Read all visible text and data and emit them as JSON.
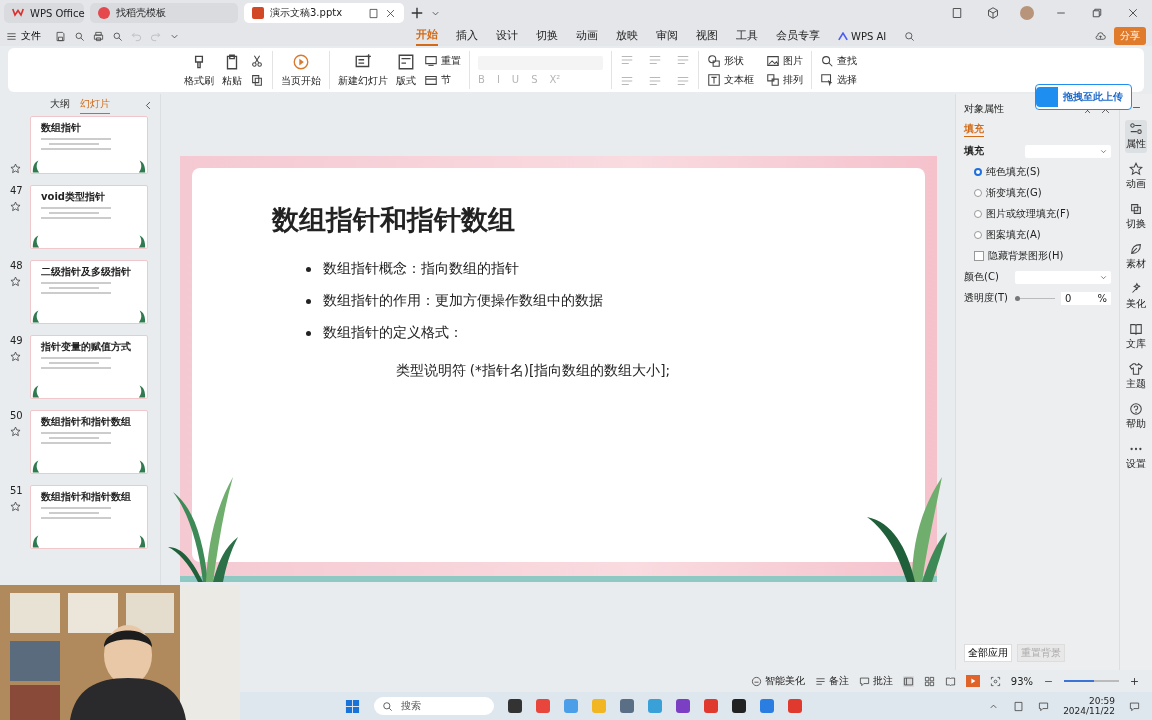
{
  "title_tabs": [
    {
      "label": "WPS Office",
      "selected": false
    },
    {
      "label": "找稻壳模板",
      "selected": false
    },
    {
      "label": "演示文稿3.pptx",
      "selected": true
    }
  ],
  "file_menu": "文件",
  "ribbon_tabs": [
    {
      "label": "开始",
      "selected": true
    },
    {
      "label": "插入",
      "selected": false
    },
    {
      "label": "设计",
      "selected": false
    },
    {
      "label": "切换",
      "selected": false
    },
    {
      "label": "动画",
      "selected": false
    },
    {
      "label": "放映",
      "selected": false
    },
    {
      "label": "审阅",
      "selected": false
    },
    {
      "label": "视图",
      "selected": false
    },
    {
      "label": "工具",
      "selected": false
    },
    {
      "label": "会员专享",
      "selected": false
    }
  ],
  "ai_tab": "WPS AI",
  "share_button": "分享",
  "ribbon": {
    "clipboard": [
      {
        "label": "格式刷"
      },
      {
        "label": "粘贴"
      }
    ],
    "play": "当页开始",
    "slides": [
      {
        "label": "新建幻灯片"
      },
      {
        "label": "版式"
      }
    ],
    "slide_small": [
      {
        "label": "重置"
      },
      {
        "label": "节"
      }
    ],
    "font_format": [
      "B",
      "I",
      "U",
      "S",
      "X²"
    ],
    "drawing": [
      {
        "label": "形状"
      },
      {
        "label": "图片"
      },
      {
        "label": "文本框"
      },
      {
        "label": "排列"
      }
    ],
    "editing": [
      {
        "label": "查找"
      },
      {
        "label": "选择"
      }
    ]
  },
  "upload_tip": "拖拽至此上传",
  "left_panel": {
    "tabs": [
      {
        "label": "大纲",
        "selected": false
      },
      {
        "label": "幻灯片",
        "selected": true
      }
    ],
    "slides": [
      {
        "title": "数组指针"
      },
      {
        "number": "47",
        "title": "void类型指针"
      },
      {
        "number": "48",
        "title": "二级指针及多级指针"
      },
      {
        "number": "49",
        "title": "指针变量的赋值方式"
      },
      {
        "number": "50",
        "title": "数组指针和指针数组"
      },
      {
        "number": "51",
        "title": "数组指针和指针数组"
      }
    ]
  },
  "slide": {
    "title": "数组指针和指针数组",
    "bullets": [
      "数组指针概念：指向数组的指针",
      "数组指针的作用：更加方便操作数组中的数据",
      "数组指针的定义格式："
    ],
    "formula": "类型说明符 (*指针名)[指向数组的数组大小];"
  },
  "properties": {
    "title": "对象属性",
    "tab": "填充",
    "section": "填充",
    "options": [
      {
        "kind": "radio",
        "label": "纯色填充(S)",
        "selected": true
      },
      {
        "kind": "radio",
        "label": "渐变填充(G)",
        "selected": false
      },
      {
        "kind": "radio",
        "label": "图片或纹理填充(F)",
        "selected": false
      },
      {
        "kind": "radio",
        "label": "图案填充(A)",
        "selected": false
      },
      {
        "kind": "checkbox",
        "label": "隐藏背景图形(H)",
        "checked": false
      }
    ],
    "color_label": "颜色(C)",
    "transparency_label": "透明度(T)",
    "transparency": {
      "level": 0,
      "value": "0",
      "unit": "%"
    },
    "apply_all": "全部应用",
    "reset": "重置背景"
  },
  "side_tools": [
    {
      "label": "属性",
      "selected": true
    },
    {
      "label": "动画",
      "selected": false
    },
    {
      "label": "切换",
      "selected": false
    },
    {
      "label": "素材",
      "selected": false
    },
    {
      "label": "美化",
      "selected": false
    },
    {
      "label": "文库",
      "selected": false
    },
    {
      "label": "主题",
      "selected": false
    },
    {
      "label": "帮助",
      "selected": false
    },
    {
      "label": "设置",
      "selected": false
    }
  ],
  "status_bar": {
    "beautify": "智能美化",
    "notes": "备注",
    "comments": "批注",
    "zoom": "93%",
    "zoom_slider": {
      "level": 0.55
    }
  },
  "taskbar": {
    "search_placeholder": "搜索",
    "time": "20:59",
    "date": "2024/11/22"
  }
}
